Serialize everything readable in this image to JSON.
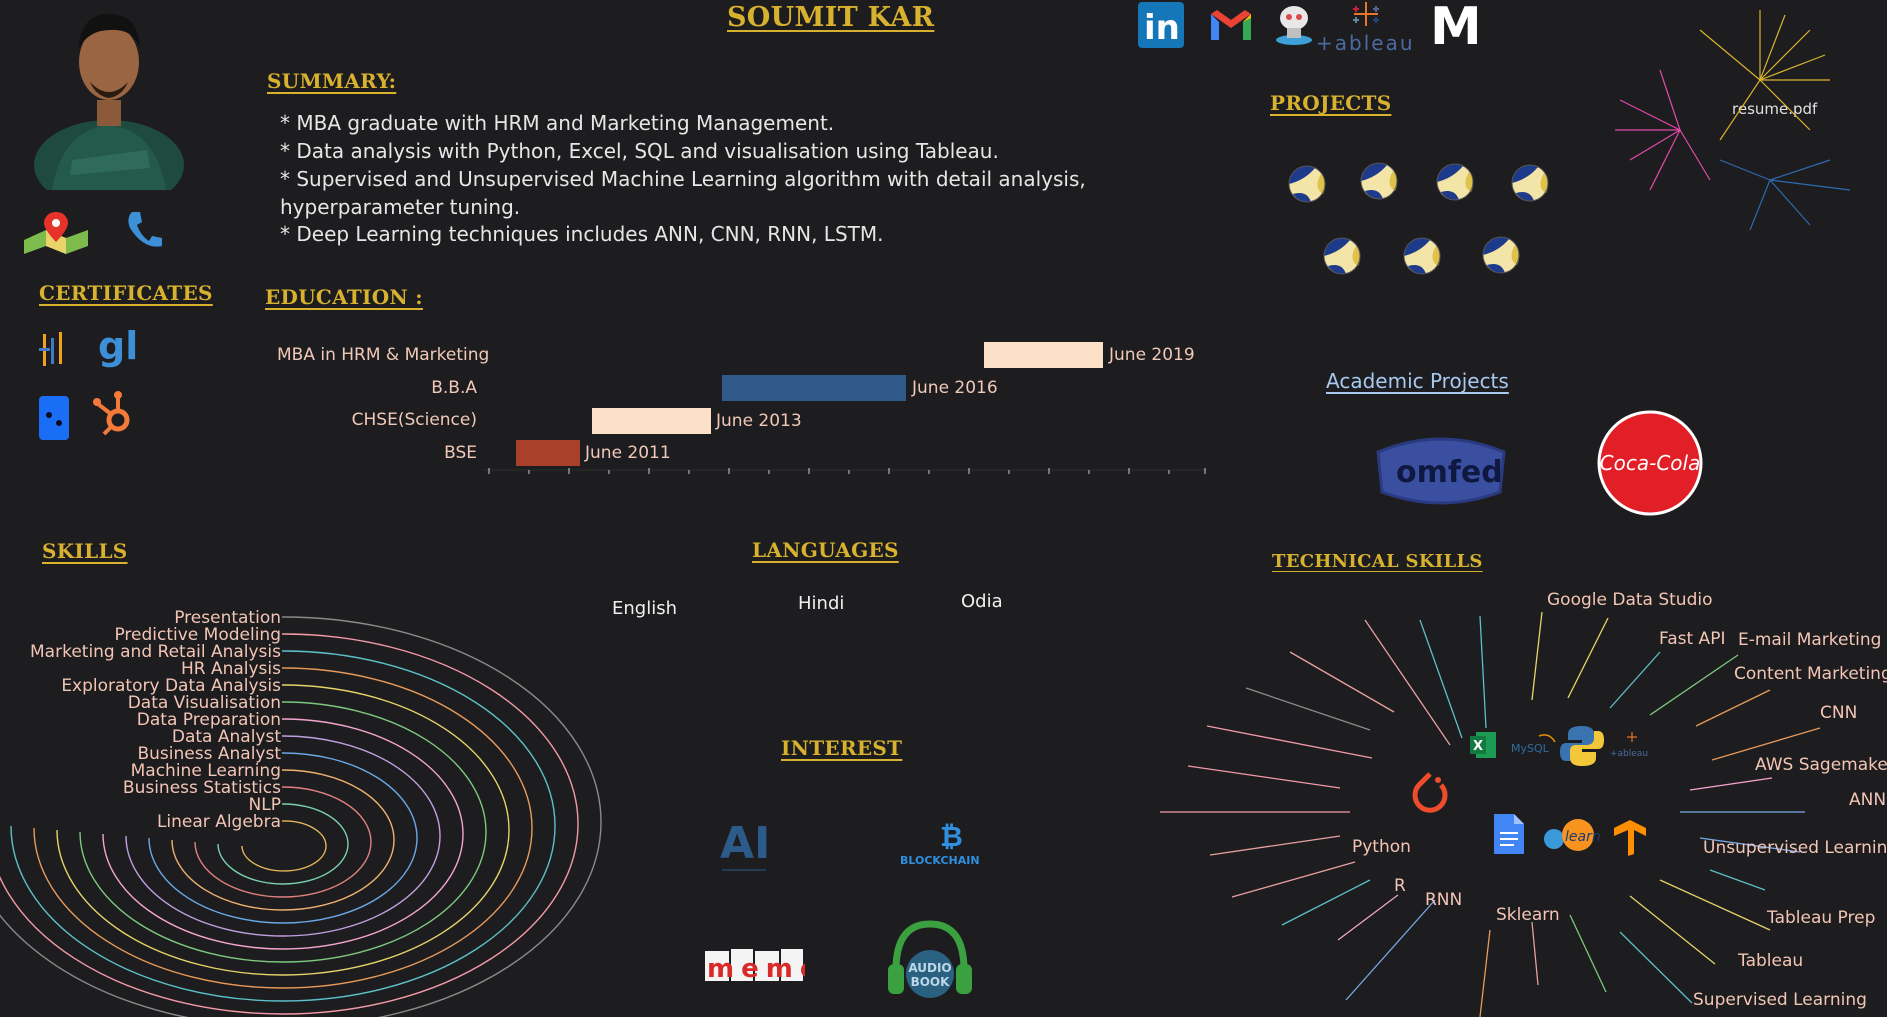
{
  "header": {
    "name": "SOUMIT KAR"
  },
  "summary": {
    "heading": "SUMMARY:",
    "lines": [
      "* MBA graduate with HRM and Marketing Management.",
      "* Data analysis with Python, Excel, SQL and visualisation using Tableau.",
      "* Supervised and Unsupervised Machine Learning algorithm with detail analysis,",
      "hyperparameter tuning.",
      "* Deep Learning techniques includes ANN, CNN, RNN, LSTM."
    ]
  },
  "education": {
    "heading": "EDUCATION :",
    "items": [
      {
        "label": "MBA in HRM & Marketing",
        "date": "June 2019",
        "color": "#fde0c8"
      },
      {
        "label": "B.B.A",
        "date": "June 2016",
        "color": "#2f5a8a"
      },
      {
        "label": "CHSE(Science)",
        "date": "June 2013",
        "color": "#fde0c8"
      },
      {
        "label": "BSE",
        "date": "June 2011",
        "color": "#a8402a"
      }
    ]
  },
  "certificates": {
    "heading": "CERTIFICATES"
  },
  "skills": {
    "heading": "SKILLS",
    "items": [
      "Presentation",
      "Predictive Modeling",
      "Marketing and Retail Analysis",
      "HR Analysis",
      "Exploratory Data Analysis",
      "Data Visualisation",
      "Data Preparation",
      "Data Analyst",
      "Business Analyst",
      "Machine Learning",
      "Business Statistics",
      "NLP",
      "Linear Algebra"
    ]
  },
  "languages": {
    "heading": "LANGUAGES",
    "items": [
      "English",
      "Hindi",
      "Odia"
    ]
  },
  "interest": {
    "heading": "INTEREST",
    "blockchain": "BLOCKCHAIN",
    "ai": "AI",
    "audiobook": "AUDIO BOOK",
    "meme": "meme"
  },
  "projects": {
    "heading": "PROJECTS",
    "academic_heading": "Academic Projects",
    "omfed": "omfed",
    "cocacola": "Coca-Cola"
  },
  "social": {
    "tableau_text": "+ableau",
    "medium": "M",
    "linkedin": "in"
  },
  "resume": {
    "link": "resume.pdf"
  },
  "technical_skills": {
    "heading": "TECHNICAL SKILLS",
    "labels": [
      "Google Data Studio",
      "Fast API",
      "E-mail Marketing",
      "Content Marketing",
      "CNN",
      "AWS Sagemaker",
      "ANN",
      "Unsupervised Learning",
      "Tableau Prep",
      "Tableau",
      "Supervised Learning",
      "Sklearn",
      "RNN",
      "R",
      "Python"
    ],
    "icon_mysql": "MySQL",
    "icon_tableau": "+ableau",
    "icon_learn": "learn"
  },
  "colors": {
    "heading": "#d8b22e",
    "background": "#1d1d1f",
    "label": "#f3c5b5"
  }
}
